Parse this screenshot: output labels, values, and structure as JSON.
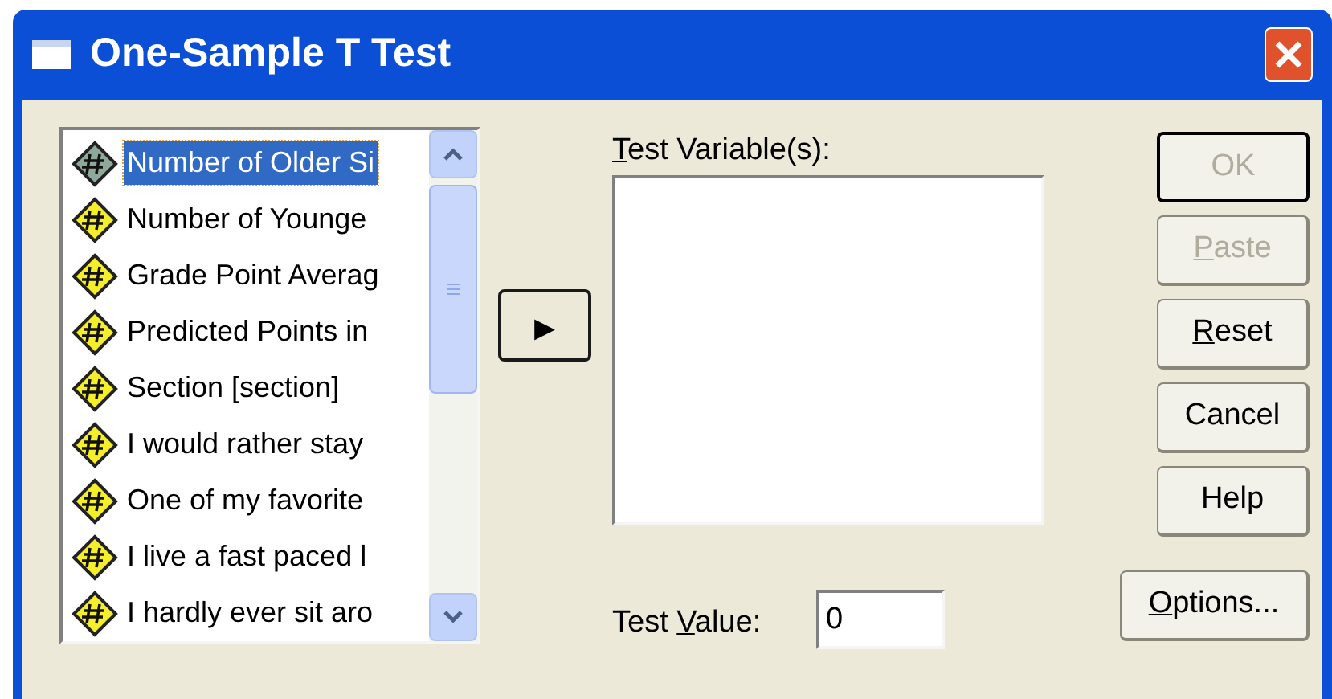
{
  "window": {
    "title": "One-Sample T Test"
  },
  "variables": [
    {
      "label": "Number of Older Si",
      "selected": true
    },
    {
      "label": "Number of Younge",
      "selected": false
    },
    {
      "label": "Grade Point Averag",
      "selected": false
    },
    {
      "label": "Predicted Points in",
      "selected": false
    },
    {
      "label": "Section [section]",
      "selected": false
    },
    {
      "label": "I would rather stay",
      "selected": false
    },
    {
      "label": "One of my favorite",
      "selected": false
    },
    {
      "label": "I live a fast paced l",
      "selected": false
    },
    {
      "label": "I hardly ever sit aro",
      "selected": false
    }
  ],
  "move_button": {
    "glyph": "▸"
  },
  "test_variables": {
    "label": {
      "key": "T",
      "post": "est Variable(s):"
    }
  },
  "test_value": {
    "label": {
      "pre": "Test ",
      "key": "V",
      "post": "alue:"
    },
    "value": "0"
  },
  "buttons": [
    {
      "label": {
        "pre": "OK"
      },
      "disabled": true,
      "default": true
    },
    {
      "label": {
        "key": "P",
        "post": "aste"
      },
      "disabled": true,
      "default": false
    },
    {
      "label": {
        "key": "R",
        "post": "eset"
      },
      "disabled": false,
      "default": false
    },
    {
      "label": {
        "pre": "Cancel"
      },
      "disabled": false,
      "default": false
    },
    {
      "label": {
        "pre": "Help"
      },
      "disabled": false,
      "default": false
    }
  ],
  "options_button": {
    "label": {
      "key": "O",
      "post": "ptions..."
    },
    "disabled": false
  }
}
